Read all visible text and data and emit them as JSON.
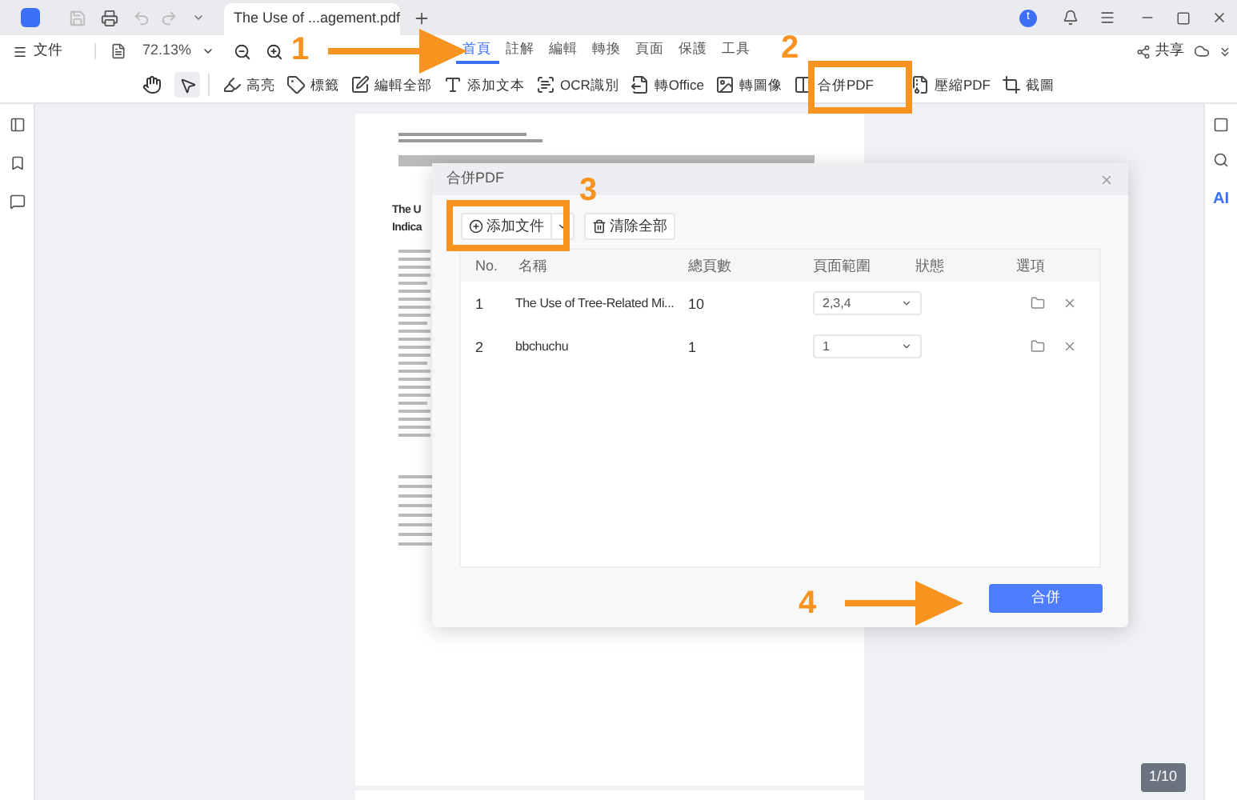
{
  "window": {
    "tab_title": "The Use of ...agement.pdf",
    "avatar": "t"
  },
  "toolbar": {
    "file_menu": "文件",
    "zoom": "72.13%",
    "share": "共享"
  },
  "ribbon_tabs": [
    {
      "label": "首頁",
      "selected": true
    },
    {
      "label": "註解",
      "selected": false
    },
    {
      "label": "編輯",
      "selected": false
    },
    {
      "label": "轉換",
      "selected": false
    },
    {
      "label": "頁面",
      "selected": false
    },
    {
      "label": "保護",
      "selected": false
    },
    {
      "label": "工具",
      "selected": false
    }
  ],
  "tools": [
    {
      "label": "高亮"
    },
    {
      "label": "標籤"
    },
    {
      "label": "編輯全部"
    },
    {
      "label": "添加文本"
    },
    {
      "label": "OCR識別"
    },
    {
      "label": "轉Office"
    },
    {
      "label": "轉圖像"
    },
    {
      "label": "合併PDF"
    },
    {
      "label": "壓縮PDF"
    },
    {
      "label": "截圖"
    }
  ],
  "pdf_page": {
    "title_lines": [
      "The U",
      "Indica"
    ]
  },
  "dialog": {
    "title": "合併PDF",
    "add_button": "添加文件",
    "clear_button": "清除全部",
    "columns": [
      "No.",
      "名稱",
      "總頁數",
      "頁面範圍",
      "狀態",
      "選項"
    ],
    "rows": [
      {
        "no": "1",
        "name": "The Use of Tree-Related Mi...",
        "pages": "10",
        "range": "2,3,4"
      },
      {
        "no": "2",
        "name": "bbchuchu",
        "pages": "1",
        "range": "1"
      }
    ],
    "merge_button": "合併"
  },
  "page_indicator": "1/10",
  "right_rail": {
    "ai_label": "AI"
  },
  "annotations": [
    "1",
    "2",
    "3",
    "4"
  ]
}
